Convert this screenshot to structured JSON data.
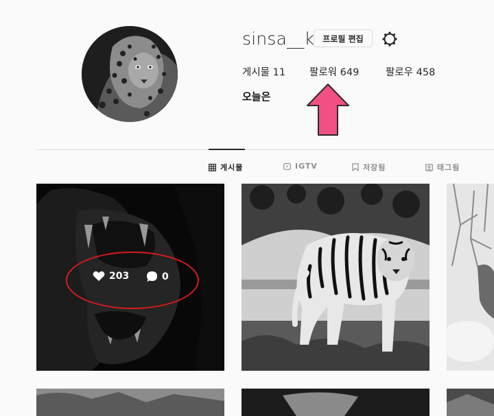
{
  "profile": {
    "username": "sinsa__k",
    "edit_button": "프로필 편집",
    "stats": {
      "posts_label": "게시물",
      "posts_count": "11",
      "followers_label": "팔로워",
      "followers_count": "649",
      "following_label": "팔로우",
      "following_count": "458"
    },
    "bio": "오늘은"
  },
  "tabs": [
    {
      "label": "게시물",
      "icon": "grid-icon",
      "active": true
    },
    {
      "label": "IGTV",
      "icon": "igtv-icon",
      "active": false
    },
    {
      "label": "저장됨",
      "icon": "bookmark-icon",
      "active": false
    },
    {
      "label": "태그됨",
      "icon": "tag-icon",
      "active": false
    }
  ],
  "posts": [
    {
      "likes": "203",
      "comments": "0",
      "hovered": true
    },
    {
      "hovered": false
    },
    {
      "hovered": false
    }
  ],
  "annotations": {
    "arrow_color": "#f24f82",
    "oval_color": "#d81b1b"
  }
}
